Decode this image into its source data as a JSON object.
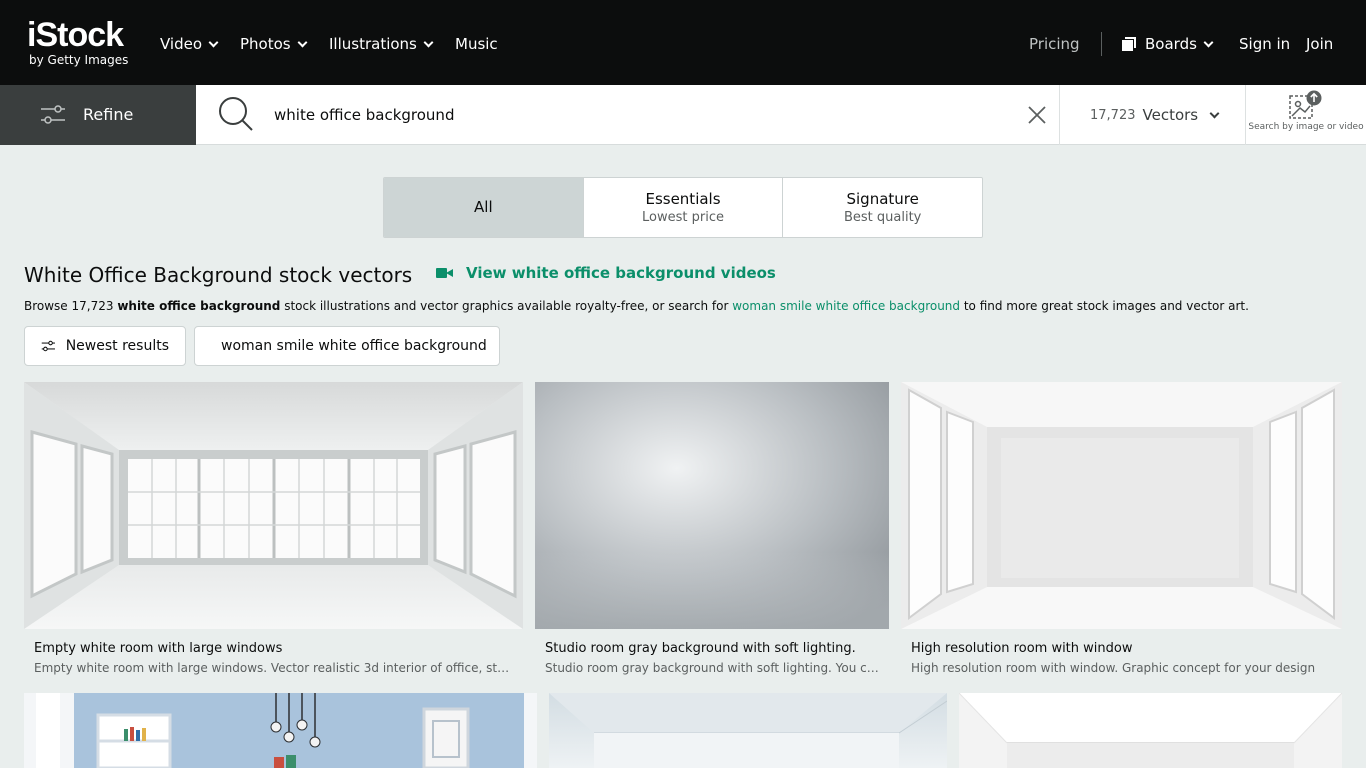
{
  "logo": {
    "main": "iStock",
    "sub": "by Getty Images"
  },
  "nav": {
    "items": [
      {
        "label": "Video"
      },
      {
        "label": "Photos"
      },
      {
        "label": "Illustrations"
      },
      {
        "label": "Music"
      }
    ],
    "pricing": "Pricing",
    "boards": "Boards",
    "sign_in": "Sign in",
    "join": "Join"
  },
  "search": {
    "refine_label": "Refine",
    "query": "white office background",
    "result_count": "17,723",
    "type_label": "Vectors",
    "image_search_label": "Search by image or video"
  },
  "tabs": [
    {
      "title": "All",
      "subtitle": ""
    },
    {
      "title": "Essentials",
      "subtitle": "Lowest price"
    },
    {
      "title": "Signature",
      "subtitle": "Best quality"
    }
  ],
  "heading": {
    "title": "White Office Background stock vectors",
    "video_link": "View white office background videos"
  },
  "browse": {
    "prefix": "Browse 17,723 ",
    "bold": "white office background",
    "middle": " stock illustrations and vector graphics available royalty-free, or search for ",
    "link": "woman smile white office background",
    "suffix": " to find more great stock images and vector art."
  },
  "chips": {
    "newest": "Newest results",
    "suggestion": "woman smile white office background"
  },
  "results": [
    {
      "title": "Empty white room with large windows",
      "description": "Empty white room with large windows. Vector realistic 3d interior of office, studio, ..."
    },
    {
      "title": "Studio room gray background with soft lighting.",
      "description": "Studio room gray background with soft lighting. You can ..."
    },
    {
      "title": "High resolution room with window",
      "description": "High resolution room with window. Graphic concept for your design"
    }
  ],
  "colors": {
    "accent": "#0b8f6a",
    "nav_bg": "#0c0d0d",
    "page_bg": "#e9eeed"
  }
}
